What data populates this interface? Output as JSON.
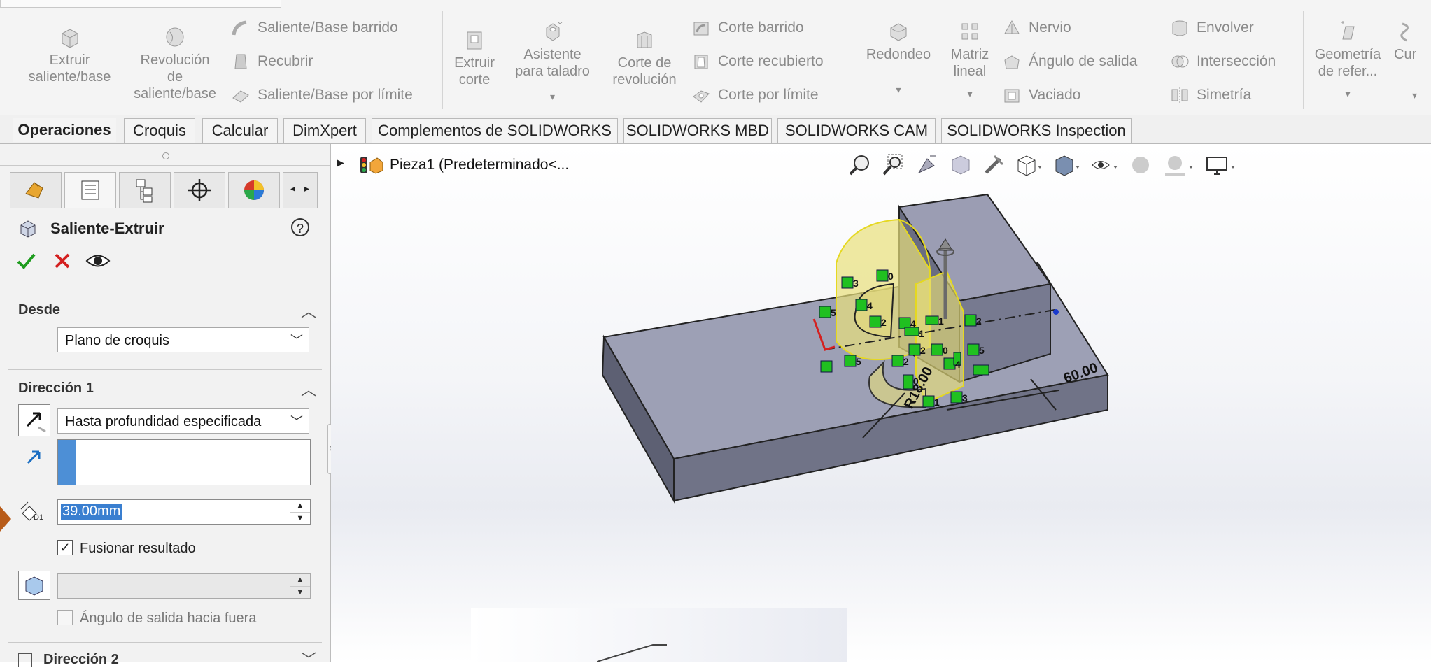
{
  "ribbon": {
    "extrude_boss": "Extruir\nsaliente/base",
    "revolve_boss": "Revolución\nde\nsaliente/base",
    "swept_boss": "Saliente/Base barrido",
    "loft": "Recubrir",
    "boundary_boss": "Saliente/Base por límite",
    "extrude_cut": "Extruir\ncorte",
    "hole_wizard": "Asistente\npara taladro",
    "revolve_cut": "Corte de\nrevolución",
    "swept_cut": "Corte barrido",
    "lofted_cut": "Corte recubierto",
    "boundary_cut": "Corte por límite",
    "fillet": "Redondeo",
    "linear_pattern": "Matriz\nlineal",
    "rib": "Nervio",
    "draft": "Ángulo de salida",
    "shell": "Vaciado",
    "wrap": "Envolver",
    "intersect": "Intersección",
    "mirror": "Simetría",
    "ref_geometry": "Geometría\nde refer...",
    "curves": "Cur"
  },
  "tabs": [
    "Operaciones",
    "Croquis",
    "Calcular",
    "DimXpert",
    "Complementos de SOLIDWORKS",
    "SOLIDWORKS MBD",
    "SOLIDWORKS CAM",
    "SOLIDWORKS Inspection"
  ],
  "panel": {
    "title": "Saliente-Extruir",
    "from_label": "Desde",
    "from_value": "Plano de croquis",
    "dir1_label": "Dirección 1",
    "end_condition": "Hasta profundidad especificada",
    "depth": "39.00mm",
    "merge_label": "Fusionar resultado",
    "merge_checked": true,
    "draft_label": "Ángulo de salida hacia fuera",
    "dir2_label": "Dirección 2",
    "depth_icon_text": "D1"
  },
  "tree": {
    "part_name": "Pieza1  (Predeterminado<..."
  },
  "model": {
    "dim_r": "R18.00",
    "dim_len": "60.00",
    "relation_labels": [
      "0",
      "3",
      "4",
      "5",
      "2",
      "4",
      "1",
      "1",
      "2",
      "2",
      "0",
      "5",
      "5",
      "2",
      "4",
      "0",
      "1",
      "3"
    ]
  },
  "colors": {
    "accent_green": "#1e9c1e",
    "cancel_red": "#d42020",
    "selection_blue": "#4d8fd6",
    "body_gray": "#8e90a8",
    "preview_yellow": "#e8df7a",
    "relation_green": "#20c020"
  }
}
